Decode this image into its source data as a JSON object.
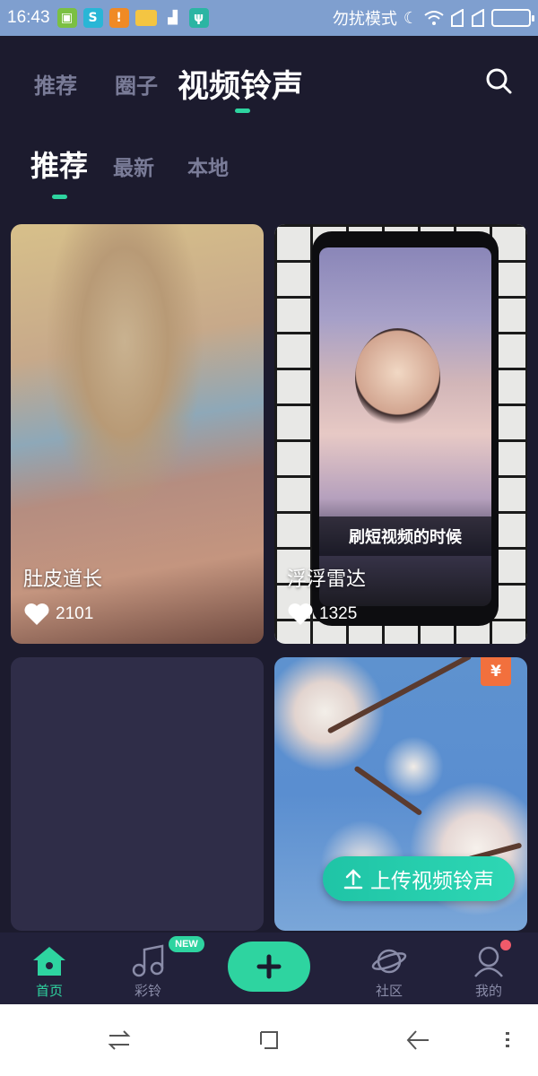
{
  "status_bar": {
    "time": "16:43",
    "dnd_label": "勿扰模式",
    "icons": [
      "android-icon",
      "app-icon",
      "warning-icon",
      "folder-icon",
      "brush-icon",
      "usb-icon",
      "moon-icon",
      "wifi-icon",
      "signal-icon",
      "signal-icon",
      "battery-icon"
    ]
  },
  "top_tabs": {
    "tab1": "推荐",
    "tab2": "圈子",
    "tab3": "视频铃声",
    "active_index": 2
  },
  "sub_tabs": {
    "tab1": "推荐",
    "tab2": "最新",
    "tab3": "本地",
    "active_index": 0
  },
  "cards": [
    {
      "title": "肚皮道长",
      "likes": "2101"
    },
    {
      "title": "浮浮雷达",
      "likes": "1325",
      "overlay_caption": "刷短视频的时候"
    },
    {
      "title": "",
      "likes": ""
    },
    {
      "title": "",
      "likes": "",
      "badge": "¥"
    }
  ],
  "upload_button": {
    "label": "上传视频铃声"
  },
  "bottom_nav": {
    "home": "首页",
    "ringtone": "彩铃",
    "new_badge": "NEW",
    "community": "社区",
    "mine": "我的"
  },
  "colors": {
    "accent": "#2ed4a0",
    "background": "#1c1b2e",
    "badge_orange": "#f2703d",
    "notification_red": "#f05a6a"
  }
}
